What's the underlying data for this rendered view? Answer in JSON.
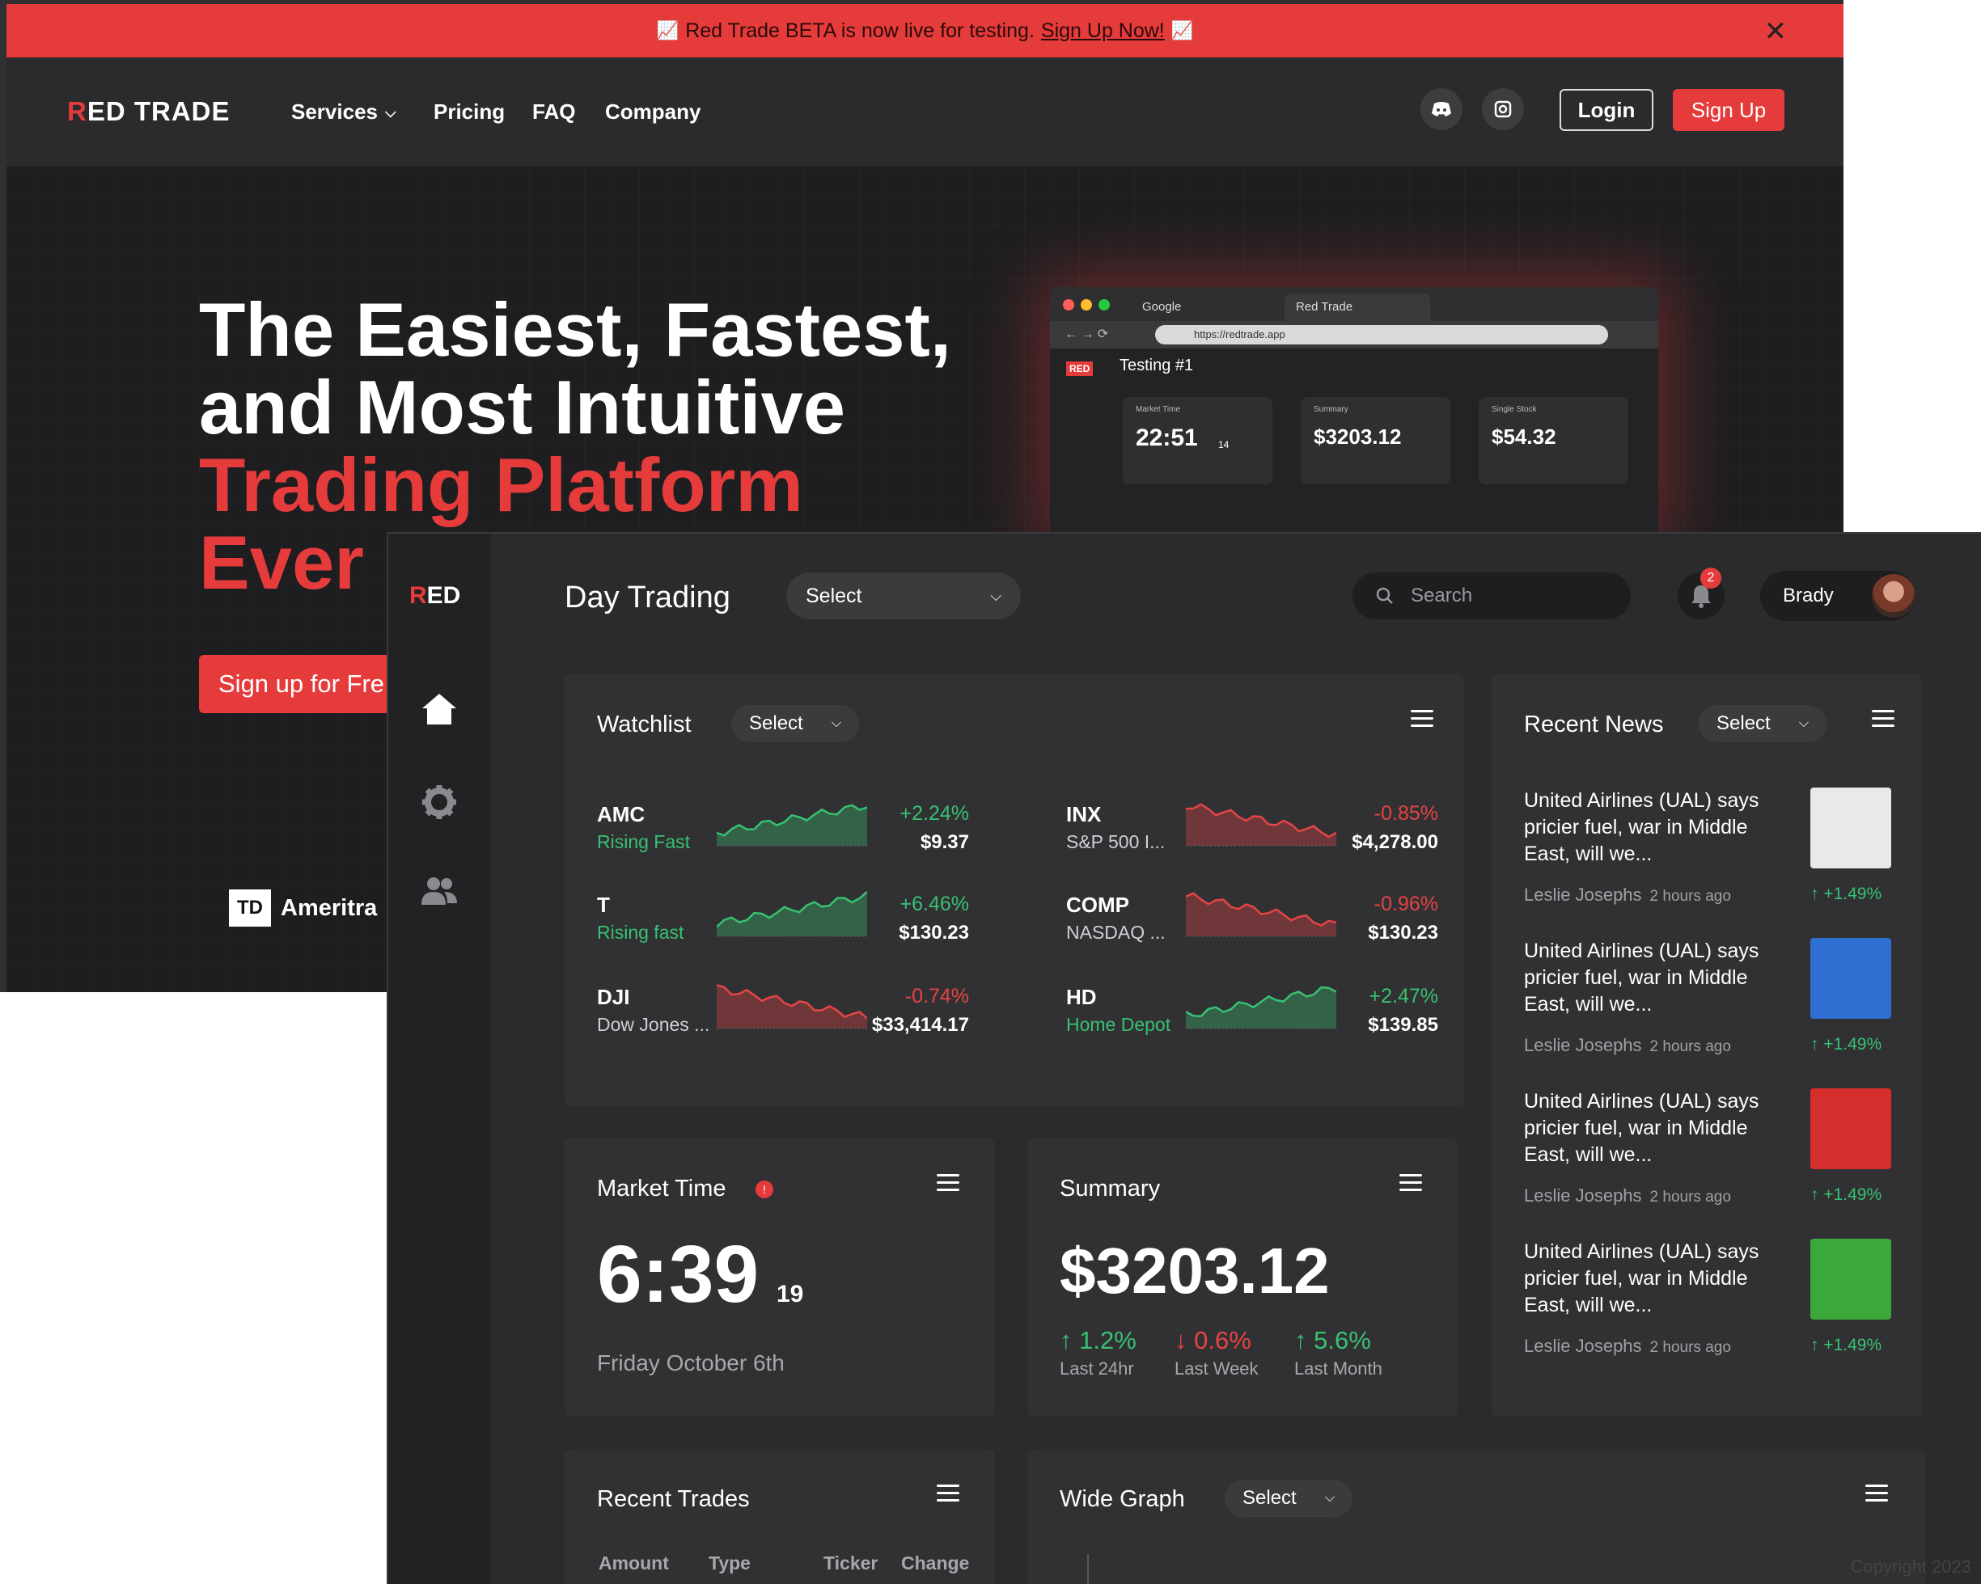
{
  "banner": {
    "emoji": "📈",
    "text": "Red Trade BETA is now live for testing.",
    "link": "Sign Up Now!",
    "close": "✕"
  },
  "landing": {
    "logo": "RED TRADE",
    "nav": [
      "Services",
      "Pricing",
      "FAQ",
      "Company"
    ],
    "login": "Login",
    "signup": "Sign Up",
    "hero": {
      "line1": "The Easiest, Fastest,",
      "line2": "and Most Intuitive",
      "line3": "Trading Platform",
      "line4": "Ever"
    },
    "cta": "Sign up for Fre",
    "partner": "Ameritra",
    "partner_mark": "TD"
  },
  "preview": {
    "tab1": "Google",
    "tab2": "Red Trade",
    "url": "https://redtrade.app",
    "title": "Testing #1",
    "logo": "RED",
    "cards": [
      {
        "title": "Market Time",
        "value": "22:51",
        "sub": "14"
      },
      {
        "title": "Summary",
        "value": "$3203.12"
      },
      {
        "title": "Single Stock",
        "value": "$54.32"
      }
    ]
  },
  "dashboard": {
    "logo": "RED",
    "title": "Day Trading",
    "select": "Select",
    "search_placeholder": "Search",
    "notifications": "2",
    "user": "Brady",
    "watchlist": {
      "title": "Watchlist",
      "select": "Select",
      "items": [
        {
          "symbol": "AMC",
          "name": "Rising Fast",
          "change": "+2.24%",
          "price": "$9.37",
          "up": true
        },
        {
          "symbol": "INX",
          "name": "S&P 500 I...",
          "change": "-0.85%",
          "price": "$4,278.00",
          "up": false
        },
        {
          "symbol": "T",
          "name": "Rising fast",
          "change": "+6.46%",
          "price": "$130.23",
          "up": true
        },
        {
          "symbol": "COMP",
          "name": "NASDAQ ...",
          "change": "-0.96%",
          "price": "$130.23",
          "up": false
        },
        {
          "symbol": "DJI",
          "name": "Dow Jones ...",
          "change": "-0.74%",
          "price": "$33,414.17",
          "up": false
        },
        {
          "symbol": "HD",
          "name": "Home Depot",
          "change": "+2.47%",
          "price": "$139.85",
          "up": true
        }
      ]
    },
    "news": {
      "title": "Recent News",
      "select": "Select",
      "items": [
        {
          "headline": "United Airlines (UAL) says pricier fuel, war in Middle East, will we...",
          "author": "Leslie Josephs",
          "ago": "2 hours ago",
          "change": "↑ +1.49%",
          "thumb": "#e9e9e9"
        },
        {
          "headline": "United Airlines (UAL) says pricier fuel, war in Middle East, will we...",
          "author": "Leslie Josephs",
          "ago": "2 hours ago",
          "change": "↑ +1.49%",
          "thumb": "#2f6fd1"
        },
        {
          "headline": "United Airlines (UAL) says pricier fuel, war in Middle East, will we...",
          "author": "Leslie Josephs",
          "ago": "2 hours ago",
          "change": "↑ +1.49%",
          "thumb": "#d62d2d"
        },
        {
          "headline": "United Airlines (UAL) says pricier fuel, war in Middle East, will we...",
          "author": "Leslie Josephs",
          "ago": "2 hours ago",
          "change": "↑ +1.49%",
          "thumb": "#3aa83a"
        }
      ]
    },
    "market_time": {
      "title": "Market Time",
      "time": "6:39",
      "seconds": "19",
      "date": "Friday October 6th"
    },
    "summary": {
      "title": "Summary",
      "value": "$3203.12",
      "stats": [
        {
          "value": "↑ 1.2%",
          "label": "Last 24hr",
          "up": true
        },
        {
          "value": "↓ 0.6%",
          "label": "Last Week",
          "up": false
        },
        {
          "value": "↑ 5.6%",
          "label": "Last Month",
          "up": true
        }
      ]
    },
    "recent_trades": {
      "title": "Recent Trades",
      "columns": [
        "Amount",
        "Type",
        "Ticker",
        "Change"
      ]
    },
    "wide_graph": {
      "title": "Wide Graph",
      "select": "Select"
    }
  },
  "copyright": "Copyright 2023",
  "colors": {
    "accent": "#e63b3b",
    "up": "#38c172",
    "down": "#e64444"
  }
}
